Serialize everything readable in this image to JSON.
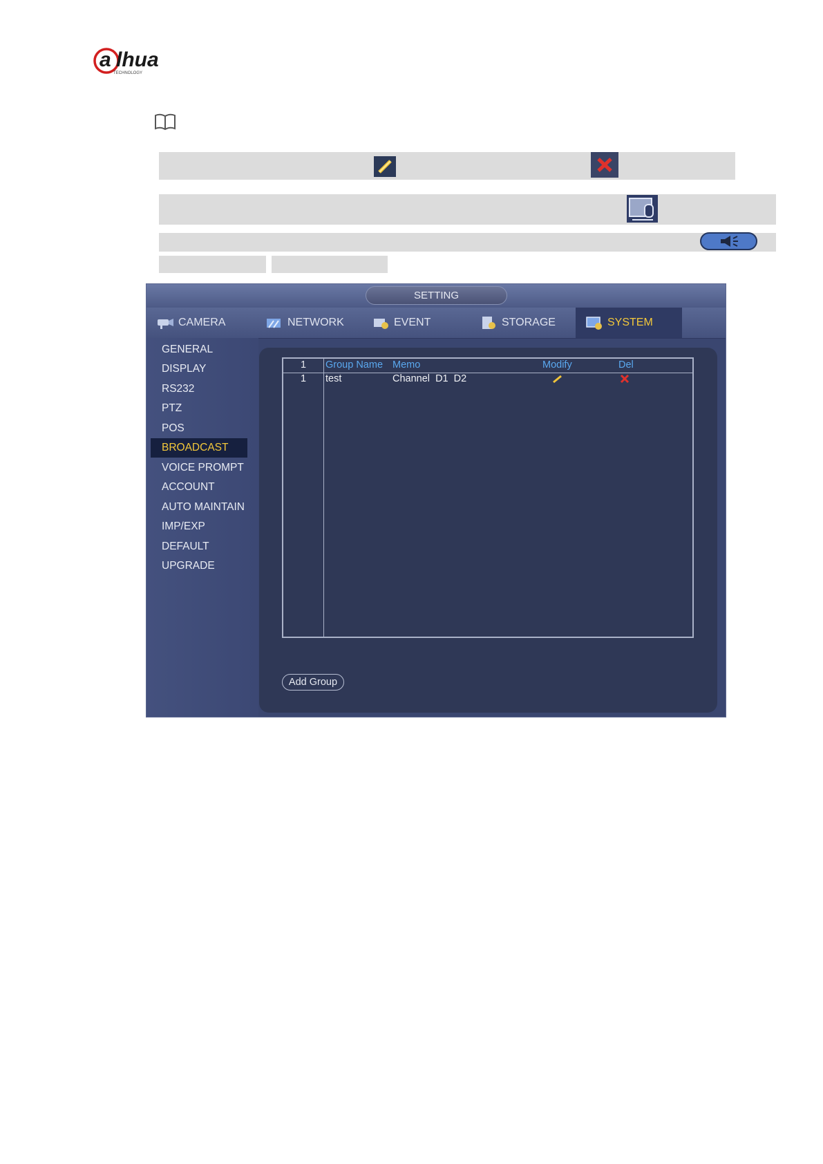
{
  "document": {
    "logo_text": "alhua",
    "logo_subtext": "TECHNOLOGY"
  },
  "window": {
    "title": "SETTING",
    "tabs": [
      {
        "label": "CAMERA",
        "icon": "camera-icon"
      },
      {
        "label": "NETWORK",
        "icon": "network-icon"
      },
      {
        "label": "EVENT",
        "icon": "event-icon"
      },
      {
        "label": "STORAGE",
        "icon": "storage-icon"
      },
      {
        "label": "SYSTEM",
        "icon": "system-icon",
        "active": true
      }
    ],
    "sidebar": [
      "GENERAL",
      "DISPLAY",
      "RS232",
      "PTZ",
      "POS",
      "BROADCAST",
      "VOICE PROMPT",
      "ACCOUNT",
      "AUTO MAINTAIN",
      "IMP/EXP",
      "DEFAULT",
      "UPGRADE"
    ],
    "sidebar_active": "BROADCAST",
    "table": {
      "columns": {
        "index": "1",
        "group_name": "Group Name",
        "memo": "Memo",
        "modify": "Modify",
        "del": "Del"
      },
      "rows": [
        {
          "index": "1",
          "group_name": "test",
          "memo": "Channel  D1  D2",
          "modify_icon": "pencil-icon",
          "del_icon": "delete-x-icon"
        }
      ]
    },
    "add_group_label": "Add Group"
  },
  "colors": {
    "accent_active": "#f3c83a",
    "header_text": "#5aa8ef",
    "delete_red": "#e0312b",
    "logo_red": "#d21f1f"
  }
}
